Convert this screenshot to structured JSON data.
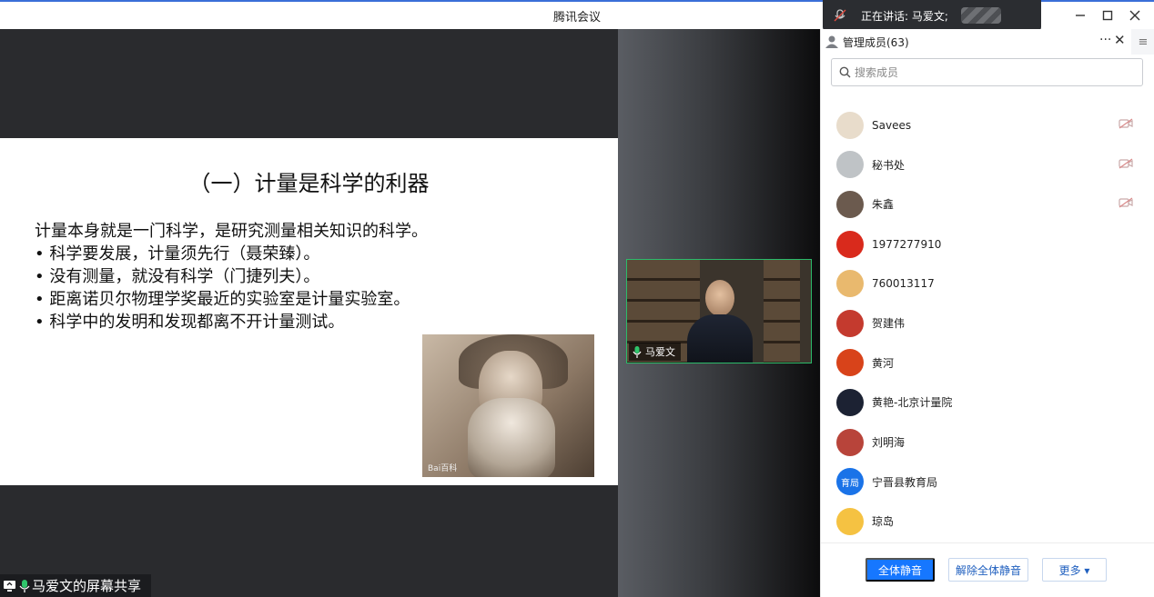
{
  "window": {
    "title": "腾讯会议"
  },
  "speaking": {
    "label": "正在讲话: 马爱文;"
  },
  "slide": {
    "title": "（一）计量是科学的利器",
    "lines": [
      "计量本身就是一门科学，是研究测量相关知识的科学。",
      "• 科学要发展，计量须先行（聂荣臻）。",
      "• 没有测量，就没有科学（门捷列夫）。",
      "• 距离诺贝尔物理学奖最近的实验室是计量实验室。",
      "• 科学中的发明和发现都离不开计量测试。"
    ],
    "image_watermark": "Bai百科"
  },
  "share_bar": {
    "label": "马爱文的屏幕共享"
  },
  "video": {
    "name": "马爱文"
  },
  "panel": {
    "title": "管理成员(63)",
    "more_label": "···",
    "close_label": "✕",
    "side_label": "≡",
    "search_placeholder": "搜索成员",
    "members": [
      {
        "name": "Savees",
        "avatar_color": "#e8dccb",
        "cam_off": true
      },
      {
        "name": "秘书处",
        "avatar_color": "#bfc3c6",
        "cam_off": true
      },
      {
        "name": "朱鑫",
        "avatar_color": "#6b5a4e",
        "cam_off": true
      },
      {
        "name": "1977277910",
        "avatar_color": "#d92a1c",
        "cam_off": false
      },
      {
        "name": "760013117",
        "avatar_color": "#e9b96e",
        "cam_off": false
      },
      {
        "name": "贺建伟",
        "avatar_color": "#c43a2e",
        "cam_off": false
      },
      {
        "name": "黄河",
        "avatar_color": "#d8431a",
        "cam_off": false
      },
      {
        "name": "黄艳-北京计量院",
        "avatar_color": "#1c2233",
        "cam_off": false
      },
      {
        "name": "刘明海",
        "avatar_color": "#b8443a",
        "cam_off": false
      },
      {
        "name": "宁晋县教育局",
        "avatar_color": "#1a73e8",
        "avatar_text": "育局",
        "cam_off": false
      },
      {
        "name": "琼岛",
        "avatar_color": "#f5c242",
        "cam_off": false
      }
    ],
    "buttons": {
      "mute_all": "全体静音",
      "unmute_all": "解除全体静音",
      "more": "更多 ▾"
    }
  }
}
